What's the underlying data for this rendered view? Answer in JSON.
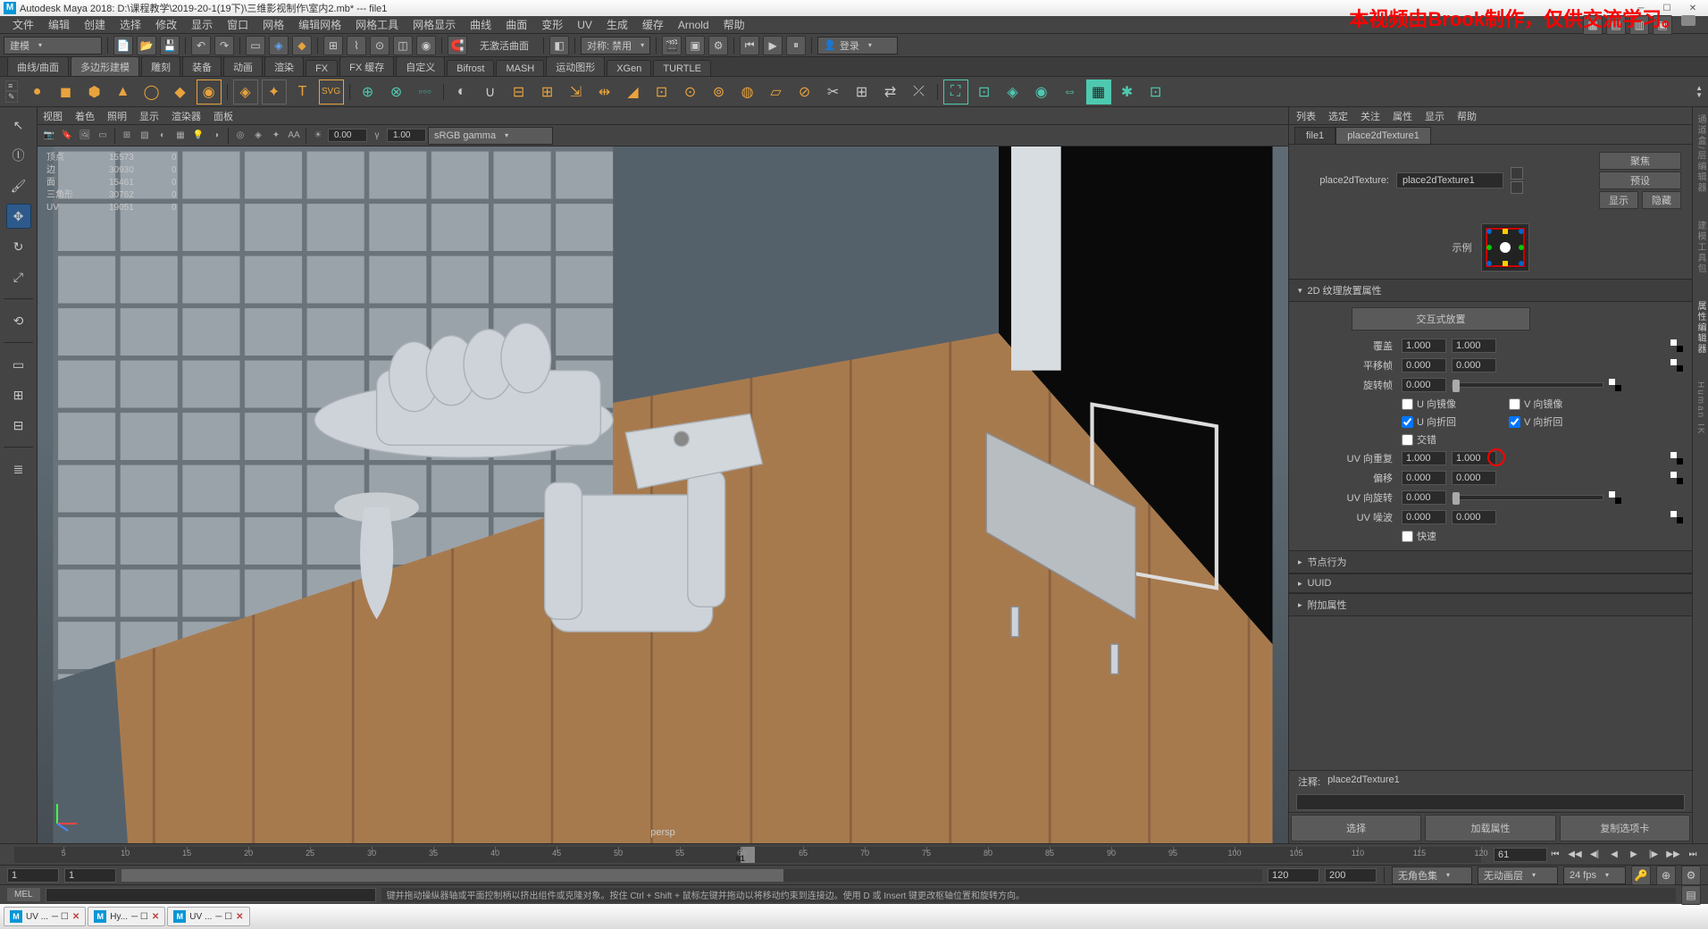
{
  "titlebar": "Autodesk Maya 2018: D:\\课程教学\\2019-20-1(19下)\\三维影视制作\\室内2.mb*  ---  file1",
  "watermark": "本视频由Brook制作，仅供交流学习。",
  "menu": [
    "文件",
    "编辑",
    "创建",
    "选择",
    "修改",
    "显示",
    "窗口",
    "网格",
    "编辑网格",
    "网格工具",
    "网格显示",
    "曲线",
    "曲面",
    "变形",
    "UV",
    "生成",
    "缓存",
    "Arnold",
    "帮助"
  ],
  "workspace": "建模",
  "status_center": "无激活曲面",
  "status_sym_label": "对称: 禁用",
  "login": "登录",
  "shelf_tabs": [
    "曲线/曲面",
    "多边形建模",
    "雕刻",
    "装备",
    "动画",
    "渲染",
    "FX",
    "FX 缓存",
    "自定义",
    "Bifrost",
    "MASH",
    "运动图形",
    "XGen",
    "TURTLE"
  ],
  "shelf_active": 1,
  "panel_menu": [
    "视图",
    "着色",
    "照明",
    "显示",
    "渲染器",
    "面板"
  ],
  "pt_val1": "0.00",
  "pt_val2": "1.00",
  "color_space": "sRGB gamma",
  "hud": [
    {
      "k": "顶点",
      "a": "15573",
      "b": "0"
    },
    {
      "k": "边",
      "a": "30930",
      "b": "0"
    },
    {
      "k": "面",
      "a": "15461",
      "b": "0"
    },
    {
      "k": "三角形",
      "a": "30762",
      "b": "0"
    },
    {
      "k": "UV",
      "a": "19051",
      "b": "0"
    }
  ],
  "persp": "persp",
  "rp_menu": [
    "列表",
    "选定",
    "关注",
    "属性",
    "显示",
    "帮助"
  ],
  "rp_tabs": [
    "file1",
    "place2dTexture1"
  ],
  "rp_tab_active": 1,
  "node_label": "place2dTexture:",
  "node_name": "place2dTexture1",
  "btn_focus": "聚焦",
  "btn_preset": "预设",
  "btn_show": "显示",
  "btn_hide": "隐藏",
  "sample_label": "示例",
  "sec_2d": "2D 纹理放置属性",
  "btn_interactive": "交互式放置",
  "attrs": {
    "coverage": {
      "l": "覆盖",
      "u": "1.000",
      "v": "1.000"
    },
    "translate": {
      "l": "平移帧",
      "u": "0.000",
      "v": "0.000"
    },
    "rotate": {
      "l": "旋转帧",
      "u": "0.000"
    },
    "mirrorU": "U 向镜像",
    "mirrorV": "V 向镜像",
    "wrapU": "U 向折回",
    "wrapV": "V 向折回",
    "stagger": "交错",
    "repeat": {
      "l": "UV 向重复",
      "u": "1.000",
      "v": "1.000"
    },
    "offset": {
      "l": "偏移",
      "u": "0.000",
      "v": "0.000"
    },
    "rotateUV": {
      "l": "UV 向旋转",
      "u": "0.000"
    },
    "noise": {
      "l": "UV 噪波",
      "u": "0.000",
      "v": "0.000"
    },
    "fast": "快速"
  },
  "sec_node": "节点行为",
  "sec_uuid": "UUID",
  "sec_extra": "附加属性",
  "notes_label": "注释:",
  "notes_val": "place2dTexture1",
  "btns": {
    "select": "选择",
    "load": "加载属性",
    "copy": "复制选项卡"
  },
  "far_tabs": [
    "通道盒/层编辑器",
    "建模工具包",
    "属性编辑器",
    "Human IK"
  ],
  "timeline": {
    "start": 1,
    "end": 120,
    "current": 61,
    "range_start": 1,
    "range_end": 200,
    "vis_start": 1,
    "vis_end": 120,
    "char_set": "无角色集",
    "anim_layer": "无动画层",
    "fps": "24 fps"
  },
  "cmd_lang": "MEL",
  "help": "键并拖动操纵器轴或平面控制柄以挤出组件或克隆对象。按住 Ctrl + Shift + 鼠标左键并拖动以将移动约束到连接边。使用 D 或 Insert 键更改枢轴位置和旋转方向。",
  "task_items": [
    "UV ...",
    "Hy...",
    "UV ..."
  ]
}
